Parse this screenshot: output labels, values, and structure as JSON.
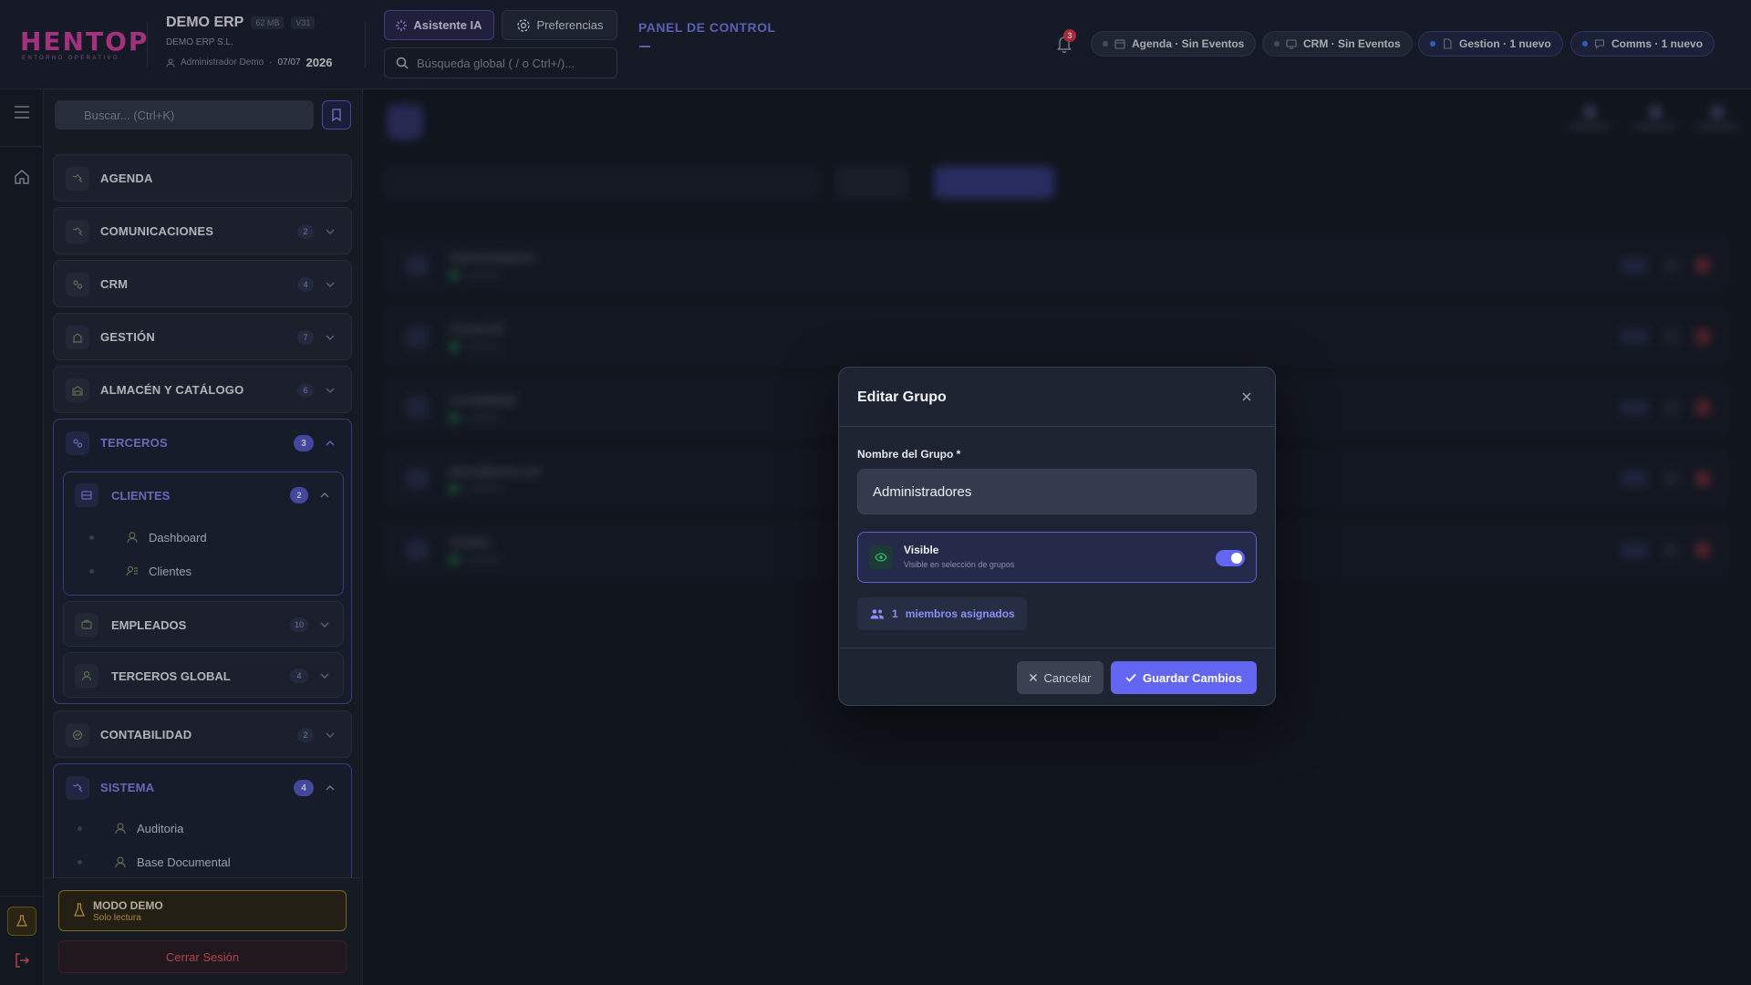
{
  "header": {
    "logo_text": "HENTOP",
    "logo_sub": "ENTORNO OPERATIVO",
    "company_name": "DEMO ERP",
    "size_badge": "62 MB",
    "version_badge": "V31",
    "company_legal": "DEMO ERP S.L.",
    "user": "Administrador Demo",
    "date": "07/07",
    "year": "2026",
    "ai_button": "Asistente IA",
    "prefs_button": "Preferencias",
    "search_placeholder": "Búsqueda global ( / o Ctrl+/)...",
    "panel_title": "PANEL DE CONTROL",
    "notifications_count": "3",
    "pills": [
      {
        "label": "Agenda · Sin Eventos",
        "icon": "calendar-icon",
        "status": "idle"
      },
      {
        "label": "CRM · Sin Eventos",
        "icon": "crm-icon",
        "status": "idle"
      },
      {
        "label": "Gestion · 1 nuevo",
        "icon": "document-icon",
        "status": "new"
      },
      {
        "label": "Comms · 1 nuevo",
        "icon": "chat-icon",
        "status": "new"
      }
    ]
  },
  "sidebar": {
    "search_placeholder": "Buscar... (Ctrl+K)",
    "sections": [
      {
        "label": "AGENDA",
        "count": ""
      },
      {
        "label": "COMUNICACIONES",
        "count": "2"
      },
      {
        "label": "CRM",
        "count": "4"
      },
      {
        "label": "GESTIÓN",
        "count": "7"
      },
      {
        "label": "ALMACÉN Y CATÁLOGO",
        "count": "6"
      }
    ],
    "terceros": {
      "label": "TERCEROS",
      "count": "3",
      "clientes": {
        "label": "CLIENTES",
        "count": "2",
        "items": [
          "Dashboard",
          "Clientes"
        ]
      },
      "empleados": {
        "label": "EMPLEADOS",
        "count": "10"
      },
      "global": {
        "label": "TERCEROS GLOBAL",
        "count": "4"
      }
    },
    "contabilidad": {
      "label": "CONTABILIDAD",
      "count": "2"
    },
    "sistema": {
      "label": "SISTEMA",
      "count": "4",
      "items": [
        "Auditoria",
        "Base Documental"
      ]
    },
    "demo_title": "MODO DEMO",
    "demo_sub": "Solo lectura",
    "logout": "Cerrar Sesión"
  },
  "background": {
    "rows": [
      "Administradores",
      "Comercial",
      "Contabilidad",
      "demo@acme.net",
      "Gestión"
    ]
  },
  "modal": {
    "title": "Editar Grupo",
    "name_label": "Nombre del Grupo *",
    "name_value": "Administradores",
    "visible_title": "Visible",
    "visible_sub": "Visible en selección de grupos",
    "visible_on": true,
    "members_count": "1",
    "members_label": "miembros asignados",
    "cancel": "Cancelar",
    "save": "Guardar Cambios"
  },
  "colors": {
    "accent": "#6366f1",
    "brand": "#e040a8",
    "danger": "#f05a66",
    "warning": "#e9b640",
    "success": "#2cb86a"
  }
}
